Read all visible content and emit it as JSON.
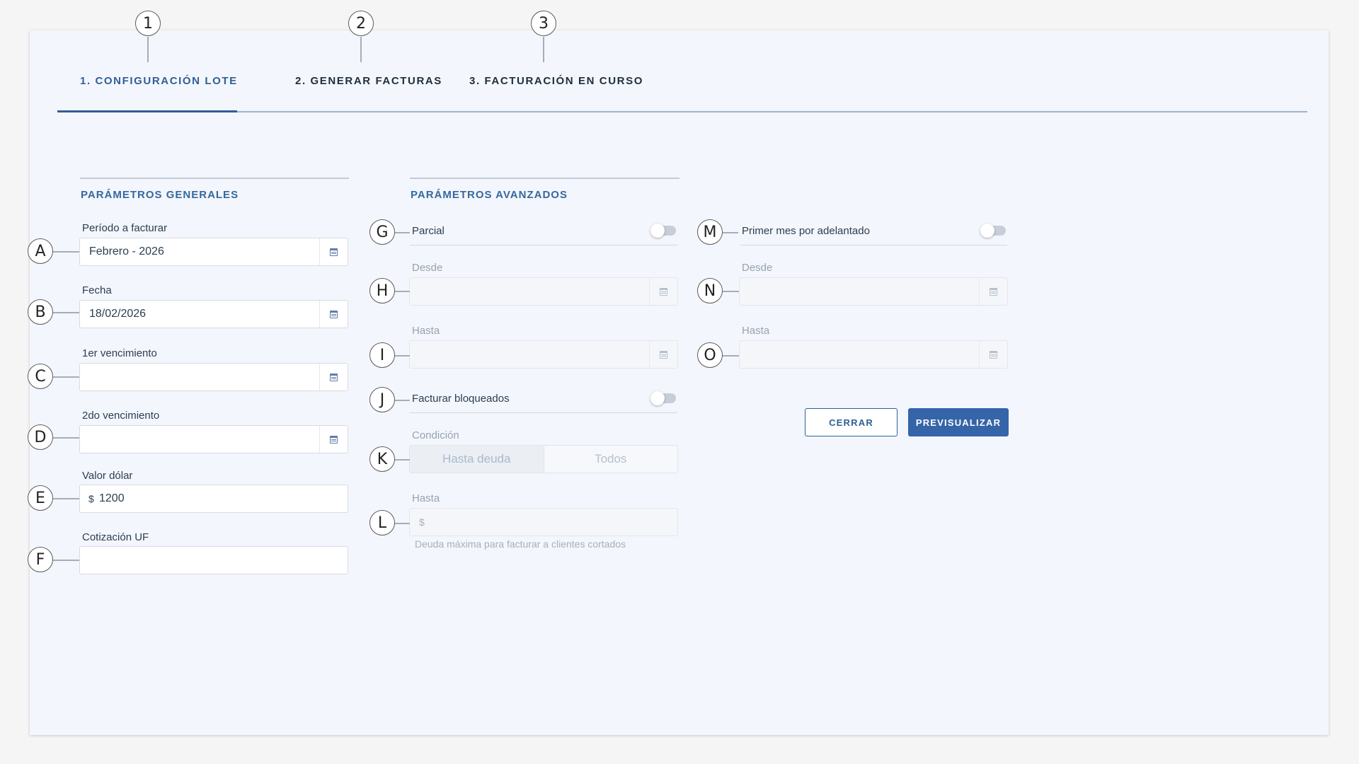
{
  "steps": [
    {
      "number": "1",
      "label": "1. CONFIGURACIÓN LOTE",
      "active": true
    },
    {
      "number": "2",
      "label": "2. GENERAR FACTURAS",
      "active": false
    },
    {
      "number": "3",
      "label": "3. FACTURACIÓN EN CURSO",
      "active": false
    }
  ],
  "general": {
    "title": "PARÁMETROS GENERALES",
    "periodo": {
      "callout": "A",
      "label": "Período a facturar",
      "value": "Febrero - 2026",
      "icon": "calendar-icon"
    },
    "fecha": {
      "callout": "B",
      "label": "Fecha",
      "value": "18/02/2026",
      "icon": "calendar-icon"
    },
    "venc1": {
      "callout": "C",
      "label": "1er vencimiento",
      "value": "",
      "icon": "calendar-icon"
    },
    "venc2": {
      "callout": "D",
      "label": "2do vencimiento",
      "value": "",
      "icon": "calendar-icon"
    },
    "dolar": {
      "callout": "E",
      "label": "Valor dólar",
      "prefix": "$",
      "value": "1200"
    },
    "uf": {
      "callout": "F",
      "label": "Cotización UF",
      "value": ""
    }
  },
  "advanced": {
    "title": "PARÁMETROS AVANZADOS",
    "parcial": {
      "callout": "G",
      "label": "Parcial",
      "enabled": false
    },
    "desde": {
      "callout": "H",
      "label": "Desde",
      "value": "",
      "icon": "calendar-icon"
    },
    "hasta": {
      "callout": "I",
      "label": "Hasta",
      "value": "",
      "icon": "calendar-icon"
    },
    "bloqueados": {
      "callout": "J",
      "label": "Facturar bloqueados",
      "enabled": false
    },
    "condicion": {
      "callout": "K",
      "label": "Condición",
      "options": [
        "Hasta deuda",
        "Todos"
      ],
      "selected": "Hasta deuda"
    },
    "hasta_deuda": {
      "callout": "L",
      "label": "Hasta",
      "prefix": "$",
      "value": "",
      "hint": "Deuda máxima para facturar a clientes cortados"
    }
  },
  "adelantado": {
    "primer_mes": {
      "callout": "M",
      "label": "Primer mes por adelantado",
      "enabled": false
    },
    "desde": {
      "callout": "N",
      "label": "Desde",
      "value": "",
      "icon": "calendar-icon"
    },
    "hasta": {
      "callout": "O",
      "label": "Hasta",
      "value": "",
      "icon": "calendar-icon"
    }
  },
  "actions": {
    "close_label": "CERRAR",
    "preview_label": "PREVISUALIZAR"
  },
  "colors": {
    "accent": "#2f5f97",
    "primary_button": "#3565a8",
    "card_bg": "#f3f6fc"
  }
}
